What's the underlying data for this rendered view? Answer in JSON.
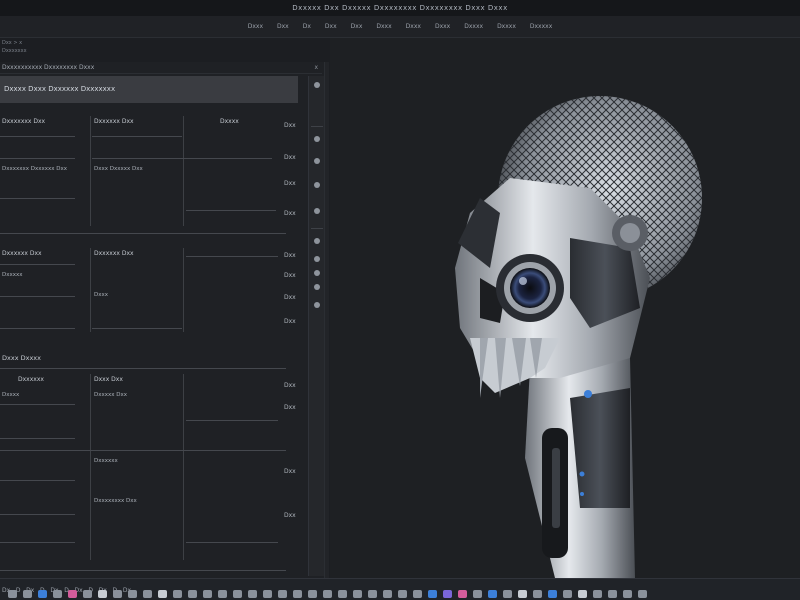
{
  "title_bar": {
    "text": "Dxxxxx Dxx Dxxxxx Dxxxxxxxx Dxxxxxxxx Dxxx Dxxx"
  },
  "menu": [
    "Dxxx",
    "Dxx",
    "Dx",
    "Dxx",
    "Dxx",
    "Dxxx",
    "Dxxx",
    "Dxxx",
    "Dxxxx",
    "Dxxxx",
    "Dxxxxx"
  ],
  "breadcrumb": [
    "Dxx > x",
    "Dxxxxxxx"
  ],
  "panel": {
    "header": "Dxxxxxxxxxx Dxxxxxxxx Dxxx",
    "close_label": "x",
    "title": "Dxxxx Dxxx Dxxxxxx Dxxxxxxx"
  },
  "section1": {
    "col_labels": [
      "Dxxxxxxx Dxx",
      "Dxxxxxx Dxx",
      "Dxxxx"
    ],
    "row_label": "Dxxxxxxx Dxxxxxx Dxx",
    "row_label_2": "Dxxx Dxxxxx Dxx",
    "right_values": [
      "Dxx",
      "Dxx",
      "Dxx",
      "Dxx"
    ]
  },
  "section2": {
    "col_labels": [
      "Dxxxxxx Dxx",
      "Dxxxxxx Dxx"
    ],
    "row_label": "Dxxxxx",
    "row_label_2": "Dxxx",
    "right_values": [
      "Dxx",
      "Dxx",
      "Dxx",
      "Dxx"
    ]
  },
  "section3": {
    "title": "Dxxx Dxxxx",
    "col_labels": [
      "Dxxxxxx",
      "Dxxx Dxx"
    ],
    "row_label": "Dxxxx",
    "row_label_2": "Dxxxxx Dxx",
    "row_label_3": "Dxxxxxx",
    "row_label_4": "Dxxxxxxxx Dxx",
    "right_values": [
      "Dxx",
      "Dxx",
      "Dxx",
      "Dxx"
    ]
  },
  "taskbar": {
    "left_labels": [
      "Dx",
      "D",
      "Dx",
      "D",
      "Dx",
      "D",
      "Dx",
      "D",
      "Dx",
      "D",
      "Dx"
    ]
  },
  "colors": {
    "background": "#1c1e22",
    "panel": "#1f2125",
    "accent_blue": "#3c7fd8",
    "metal": "#b9bec6"
  }
}
